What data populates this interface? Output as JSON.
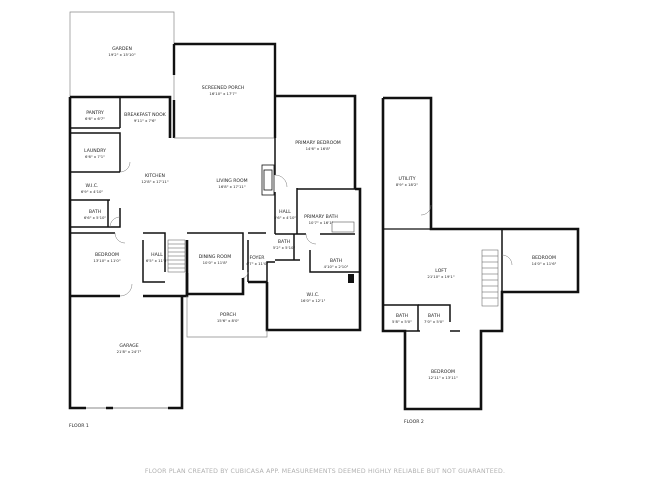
{
  "colors": {
    "wall": "#111111",
    "thin_line": "#888888",
    "text": "#222222",
    "footer": "#b0b0b0",
    "background": "#ffffff"
  },
  "rooms": {
    "garden": {
      "name": "GARDEN",
      "dims": "19'2\" x 15'10\""
    },
    "screened_porch": {
      "name": "SCREENED PORCH",
      "dims": "16'10\" x 17'7\""
    },
    "pantry": {
      "name": "PANTRY",
      "dims": "6'6\" x 6'7\""
    },
    "breakfast_nook": {
      "name": "BREAKFAST NOOK",
      "dims": "9'11\" x 7'6\""
    },
    "laundry": {
      "name": "LAUNDRY",
      "dims": "6'6\" x 7'1\""
    },
    "kitchen": {
      "name": "KITCHEN",
      "dims": "12'8\" x 17'11\""
    },
    "living_room": {
      "name": "LIVING ROOM",
      "dims": "16'8\" x 17'11\""
    },
    "primary_bedroom": {
      "name": "PRIMARY BEDROOM",
      "dims": "14'6\" x 16'8\""
    },
    "wic_1": {
      "name": "W.I.C.",
      "dims": "6'9\" x 4'10\""
    },
    "bath_1": {
      "name": "BATH",
      "dims": "6'6\" x 5'10\""
    },
    "hall_1": {
      "name": "HALL",
      "dims": "5'6\" x 4'10\""
    },
    "primary_bath": {
      "name": "PRIMARY BATH",
      "dims": "10'7\" x 16'1\""
    },
    "bedroom_1": {
      "name": "BEDROOM",
      "dims": "13'10\" x 11'0\""
    },
    "hall_2": {
      "name": "HALL",
      "dims": "6'5\" x 11'3\""
    },
    "dining_room": {
      "name": "DINING ROOM",
      "dims": "10'0\" x 11'8\""
    },
    "foyer": {
      "name": "FOYER",
      "dims": "4'7\" x 11'0\""
    },
    "bath_2": {
      "name": "BATH",
      "dims": "5'2\" x 5'10\""
    },
    "bath_3": {
      "name": "BATH",
      "dims": "4'10\" x 2'10\""
    },
    "wic_2": {
      "name": "W.I.C.",
      "dims": "16'0\" x 12'1\""
    },
    "porch": {
      "name": "PORCH",
      "dims": "15'6\" x 8'0\""
    },
    "garage": {
      "name": "GARAGE",
      "dims": "21'8\" x 24'7\""
    },
    "utility": {
      "name": "UTILITY",
      "dims": "8'9\" x 18'2\""
    },
    "loft": {
      "name": "LOFT",
      "dims": "21'10\" x 19'1\""
    },
    "bedroom_2": {
      "name": "BEDROOM",
      "dims": "14'0\" x 11'6\""
    },
    "bath_4": {
      "name": "BATH",
      "dims": "5'8\" x 5'0\""
    },
    "bath_5": {
      "name": "BATH",
      "dims": "7'0\" x 5'0\""
    },
    "bedroom_3": {
      "name": "BEDROOM",
      "dims": "12'11\" x 13'11\""
    }
  },
  "floors": {
    "floor_1": "FLOOR 1",
    "floor_2": "FLOOR 2"
  },
  "footer": "FLOOR PLAN CREATED BY CUBICASA APP. MEASUREMENTS DEEMED HIGHLY RELIABLE BUT NOT GUARANTEED."
}
